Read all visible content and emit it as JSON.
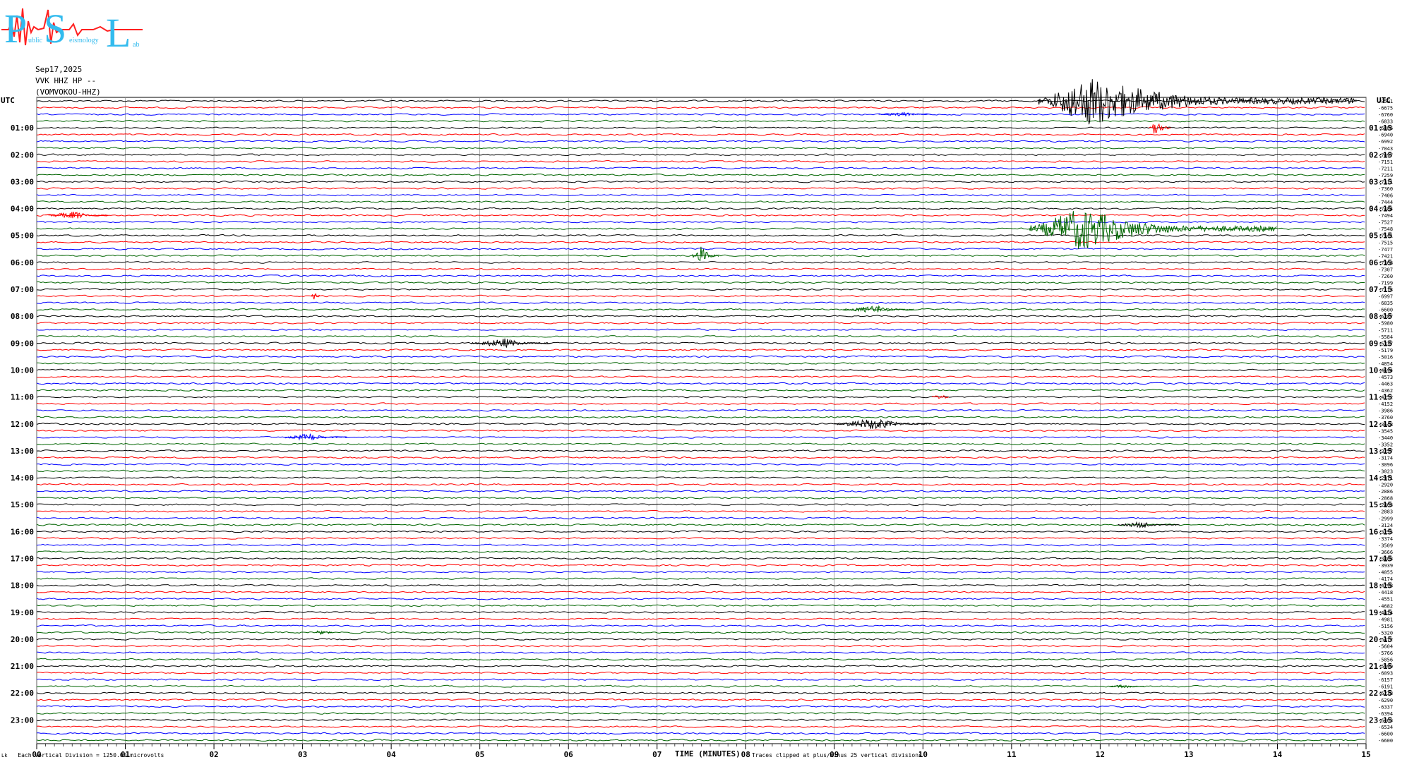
{
  "logo": {
    "letters": [
      "P",
      "S",
      "L"
    ],
    "subtitle_parts": [
      "ublic",
      "eismology",
      "ab"
    ]
  },
  "header": {
    "date": "Sep17,2025",
    "station": "VVK HHZ HP --",
    "channel": "(VOMVOKOU-HHZ)"
  },
  "chart_data": {
    "type": "line",
    "description_kind": "helicorder",
    "left_axis_title": "UTC",
    "right_axis_title": "UTC",
    "left_hour_labels": [
      "01:00",
      "02:00",
      "03:00",
      "04:00",
      "05:00",
      "06:00",
      "07:00",
      "08:00",
      "09:00",
      "10:00",
      "11:00",
      "12:00",
      "13:00",
      "14:00",
      "15:00",
      "16:00",
      "17:00",
      "18:00",
      "19:00",
      "20:00",
      "21:00",
      "22:00",
      "23:00"
    ],
    "right_hour_labels": [
      "01:15",
      "02:15",
      "03:15",
      "04:15",
      "05:15",
      "06:15",
      "07:15",
      "08:15",
      "09:15",
      "10:15",
      "11:15",
      "12:15",
      "13:15",
      "14:15",
      "15:15",
      "16:15",
      "17:15",
      "18:15",
      "19:15",
      "20:15",
      "21:15",
      "22:15",
      "23:15"
    ],
    "x_tick_labels": [
      "00",
      "01",
      "02",
      "03",
      "04",
      "05",
      "06",
      "07",
      "08",
      "09",
      "10",
      "11",
      "12",
      "13",
      "14",
      "15"
    ],
    "xlabel": "TIME (MINUTES)",
    "xlim": [
      0,
      15
    ],
    "trace_minutes": 15,
    "traces_count": 96,
    "trace_colors": [
      "#000000",
      "#ff0000",
      "#0000ff",
      "#006400"
    ],
    "trace_offsets": [
      "-8591",
      "-6675",
      "-6760",
      "-6833",
      "-6886",
      "-6940",
      "-6992",
      "-7043",
      "-7097",
      "-7151",
      "-7211",
      "-7259",
      "-7311",
      "-7360",
      "-7406",
      "-7444",
      "-7484",
      "-7494",
      "-7527",
      "-7548",
      "-7541",
      "-7515",
      "-7477",
      "-7421",
      "-7368",
      "-7307",
      "-7260",
      "-7199",
      "-7113",
      "-6997",
      "-6835",
      "-6600",
      "-6287",
      "-5980",
      "-5711",
      "-5584",
      "-5337",
      "-5179",
      "-5016",
      "-4854",
      "-4694",
      "-4573",
      "-4463",
      "-4362",
      "-4252",
      "-4152",
      "-3986",
      "-3760",
      "-3648",
      "-3545",
      "-3440",
      "-3352",
      "-3257",
      "-3174",
      "-3096",
      "-3023",
      "-2971",
      "-2920",
      "-2886",
      "-2868",
      "-2863",
      "-2883",
      "-2999",
      "-3124",
      "-3255",
      "-3374",
      "-3509",
      "-3666",
      "-3803",
      "-3939",
      "-4055",
      "-4174",
      "-4298",
      "-4418",
      "-4551",
      "-4682",
      "-4824",
      "-4981",
      "-5156",
      "-5320",
      "-5472",
      "-5604",
      "-5766",
      "-5856",
      "-5999",
      "-6093",
      "-6157",
      "-6191",
      "-6238",
      "-6290",
      "-6337",
      "-6394",
      "-6463",
      "-6534",
      "-6600",
      "-6600"
    ],
    "events": [
      {
        "trace": 0,
        "start_min": 11.3,
        "end_min": 14.9,
        "peak_min": 11.9,
        "amplitude": 36,
        "color": "#000000"
      },
      {
        "trace": 4,
        "start_min": 12.55,
        "end_min": 12.8,
        "peak_min": 12.6,
        "amplitude": 14,
        "color": "#ff0000"
      },
      {
        "trace": 2,
        "start_min": 9.5,
        "end_min": 10.1,
        "peak_min": 9.8,
        "amplitude": 3,
        "color": "#0000ff"
      },
      {
        "trace": 17,
        "start_min": 0.1,
        "end_min": 0.8,
        "peak_min": 0.45,
        "amplitude": 6,
        "color": "#ff0000"
      },
      {
        "trace": 19,
        "start_min": 11.2,
        "end_min": 14.0,
        "peak_min": 11.8,
        "amplitude": 32,
        "color": "#006400"
      },
      {
        "trace": 23,
        "start_min": 7.4,
        "end_min": 7.7,
        "peak_min": 7.5,
        "amplitude": 14,
        "color": "#006400"
      },
      {
        "trace": 29,
        "start_min": 3.1,
        "end_min": 3.2,
        "peak_min": 3.12,
        "amplitude": 6,
        "color": "#ff0000"
      },
      {
        "trace": 31,
        "start_min": 9.1,
        "end_min": 9.9,
        "peak_min": 9.5,
        "amplitude": 6,
        "color": "#006400"
      },
      {
        "trace": 36,
        "start_min": 4.9,
        "end_min": 5.8,
        "peak_min": 5.3,
        "amplitude": 7,
        "color": "#000000"
      },
      {
        "trace": 44,
        "start_min": 10.1,
        "end_min": 10.3,
        "peak_min": 10.2,
        "amplitude": 4,
        "color": "#ff0000"
      },
      {
        "trace": 48,
        "start_min": 9.0,
        "end_min": 10.1,
        "peak_min": 9.5,
        "amplitude": 9,
        "color": "#000000"
      },
      {
        "trace": 50,
        "start_min": 2.8,
        "end_min": 3.5,
        "peak_min": 3.1,
        "amplitude": 6,
        "color": "#0000ff"
      },
      {
        "trace": 63,
        "start_min": 12.2,
        "end_min": 12.9,
        "peak_min": 12.5,
        "amplitude": 5,
        "color": "#000000"
      },
      {
        "trace": 79,
        "start_min": 3.15,
        "end_min": 3.35,
        "peak_min": 3.2,
        "amplitude": 6,
        "color": "#006400"
      },
      {
        "trace": 87,
        "start_min": 12.1,
        "end_min": 12.5,
        "peak_min": 12.3,
        "amplitude": 3,
        "color": "#006400"
      }
    ]
  },
  "footer": {
    "scale_mark": "Lk",
    "vertical_division": "Each Vertical Division = 1250.00 microvolts",
    "clip_note": "Traces clipped at plus/minus 25 vertical divisions"
  }
}
